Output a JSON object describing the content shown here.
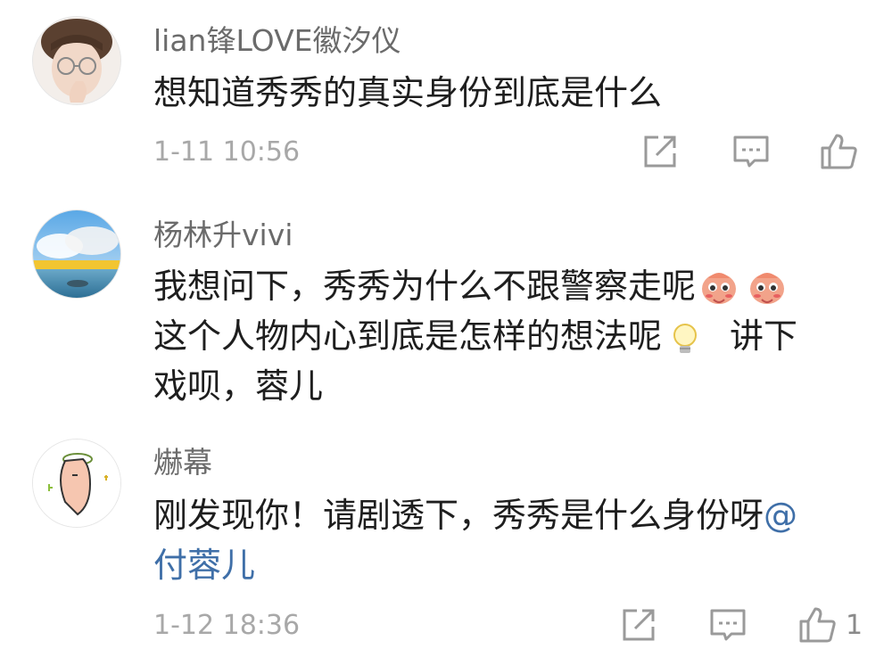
{
  "comments": [
    {
      "username": "lian锋LOVE徽汐仪",
      "text": "想知道秀秀的真实身份到底是什么",
      "time": "1-11 10:56",
      "likes": ""
    },
    {
      "username": "杨林升vivi",
      "text_line1": "我想问下，秀秀为什么不跟警察走呢",
      "text_line2": "这个人物内心到底是怎样的想法呢",
      "text_line2b": "讲下",
      "text_line3": "戏呗，蓉儿"
    },
    {
      "username": "爀幕",
      "text": "刚发现你！请剧透下，秀秀是什么身份呀",
      "mention_at": "@",
      "mention_name": "付蓉儿",
      "time": "1-12 18:36",
      "likes": "1"
    }
  ],
  "colors": {
    "username": "#6b6b6b",
    "text": "#1e1e1e",
    "meta": "#a8a8a8",
    "mention": "#3f6fa8",
    "icon": "#9a9a9a"
  }
}
